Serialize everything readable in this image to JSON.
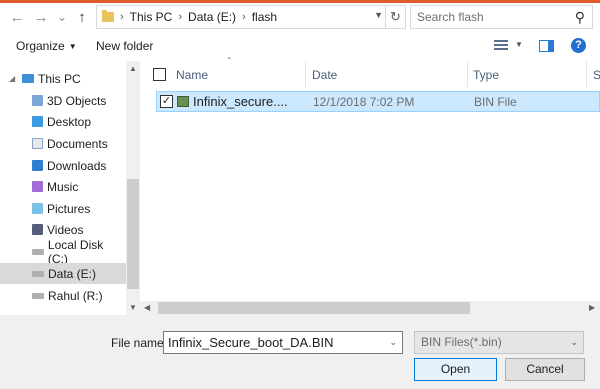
{
  "nav": {
    "back_glyph": "←",
    "forward_glyph": "→",
    "history_glyph": "⌄",
    "up_glyph": "↑"
  },
  "address": {
    "crumbs": [
      "This PC",
      "Data (E:)",
      "flash"
    ],
    "separator": "›",
    "refresh_glyph": "↻"
  },
  "search": {
    "placeholder": "Search flash",
    "icon": "search-icon"
  },
  "command_bar": {
    "organize": "Organize",
    "new_folder": "New folder",
    "help": "?"
  },
  "tree": {
    "items": [
      {
        "label": "This PC",
        "icon": "computer-icon"
      },
      {
        "label": "3D Objects",
        "icon": "folder-3d-icon"
      },
      {
        "label": "Desktop",
        "icon": "desktop-icon"
      },
      {
        "label": "Documents",
        "icon": "documents-icon"
      },
      {
        "label": "Downloads",
        "icon": "downloads-icon"
      },
      {
        "label": "Music",
        "icon": "music-icon"
      },
      {
        "label": "Pictures",
        "icon": "pictures-icon"
      },
      {
        "label": "Videos",
        "icon": "videos-icon"
      },
      {
        "label": "Local Disk (C:)",
        "icon": "drive-icon"
      },
      {
        "label": "Data (E:)",
        "icon": "drive-icon",
        "selected": true
      },
      {
        "label": "Rahul (R:)",
        "icon": "drive-icon"
      }
    ]
  },
  "columns": {
    "name": "Name",
    "date": "Date",
    "type": "Type",
    "size": "S"
  },
  "files": [
    {
      "name": "Infinix_secure....",
      "date": "12/1/2018 7:02 PM",
      "type": "BIN File",
      "checked": true
    }
  ],
  "footer": {
    "file_name_label": "File name:",
    "file_name_value": "Infinix_Secure_boot_DA.BIN",
    "filter": "BIN Files(*.bin)",
    "open": "Open",
    "cancel": "Cancel"
  },
  "colors": {
    "selection": "#cce8ff",
    "accent": "#0078d7"
  }
}
